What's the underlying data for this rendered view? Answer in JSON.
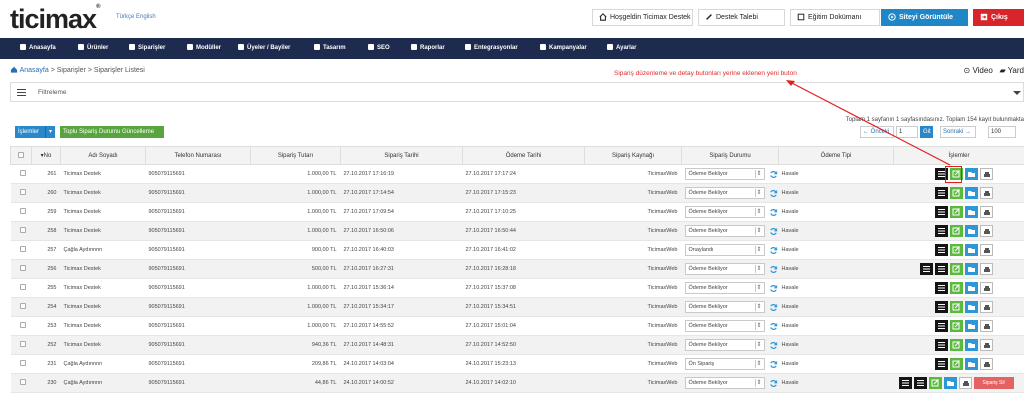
{
  "header": {
    "logo": "ticimax",
    "lang": "Türkçe English",
    "welcome": "Hoşgeldin Ticimax Destek",
    "support": "Destek Talebi",
    "docs": "Eğitim Dokümanı",
    "site": "Siteyi Görüntüle",
    "logout": "Çıkış"
  },
  "nav": [
    "Anasayfa",
    "Ürünler",
    "Siparişler",
    "Modüller",
    "Üyeler / Bayiler",
    "Tasarım",
    "SEO",
    "Raporlar",
    "Entegrasyonlar",
    "Kampanyalar",
    "Ayarlar"
  ],
  "breadcrumb": {
    "home": "Anasayfa",
    "rest": " > Siparişler > Siparişler Listesi"
  },
  "annotation": "Sipariş düzenleme ve detay butonları yerine eklenen yeni buton",
  "video": "Video",
  "yardim": "Yard",
  "filter_label": "Filtreleme",
  "actions": {
    "islemler": "İşlemler",
    "toplu": "Toplu Sipariş Durumu Güncelleme"
  },
  "pager": {
    "info": "Toplam 1 sayfanın 1 sayfasındasınız. Toplam 154 kayıt bulunmakta",
    "prev": "← Önceki",
    "page": "1",
    "go": "Git",
    "next": "Sonraki →",
    "perpage": "100"
  },
  "columns": [
    "",
    "No",
    "Adı Soyadı",
    "Telefon Numarası",
    "Sipariş Tutarı",
    "Sipariş Tarihi",
    "Ödeme Tarihi",
    "Sipariş Kaynağı",
    "Sipariş Durumu",
    "Ödeme Tipi",
    "İşlemler"
  ],
  "rows": [
    {
      "no": "261",
      "name": "Ticimax Destek",
      "phone": "905079115691",
      "amount": "1.000,00 TL",
      "date": "27.10.2017 17:16:19",
      "paid": "27.10.2017 17:17:24",
      "source": "TicimaxWeb",
      "status": "Ödeme Bekliyor",
      "ptype": "Havale"
    },
    {
      "no": "260",
      "name": "Ticimax Destek",
      "phone": "905079115691",
      "amount": "1.000,00 TL",
      "date": "27.10.2017 17:14:54",
      "paid": "27.10.2017 17:15:23",
      "source": "TicimaxWeb",
      "status": "Ödeme Bekliyor",
      "ptype": "Havale"
    },
    {
      "no": "259",
      "name": "Ticimax Destek",
      "phone": "905079115691",
      "amount": "1.000,00 TL",
      "date": "27.10.2017 17:09:54",
      "paid": "27.10.2017 17:10:25",
      "source": "TicimaxWeb",
      "status": "Ödeme Bekliyor",
      "ptype": "Havale"
    },
    {
      "no": "258",
      "name": "Ticimax Destek",
      "phone": "905079115691",
      "amount": "1.000,00 TL",
      "date": "27.10.2017 16:50:06",
      "paid": "27.10.2017 16:50:44",
      "source": "TicimaxWeb",
      "status": "Ödeme Bekliyor",
      "ptype": "Havale"
    },
    {
      "no": "257",
      "name": "Çağla Aydınnnn",
      "phone": "905079115691",
      "amount": "900,00 TL",
      "date": "27.10.2017 16:40:03",
      "paid": "27.10.2017 16:41:02",
      "source": "TicimaxWeb",
      "status": "Onaylandı",
      "ptype": "Havale"
    },
    {
      "no": "256",
      "name": "Ticimax Destek",
      "phone": "905079115691",
      "amount": "500,00 TL",
      "date": "27.10.2017 16:27:31",
      "paid": "27.10.2017 16:28:18",
      "source": "TicimaxWeb",
      "status": "Ödeme Bekliyor",
      "ptype": "Havale"
    },
    {
      "no": "255",
      "name": "Ticimax Destek",
      "phone": "905079115691",
      "amount": "1.000,00 TL",
      "date": "27.10.2017 15:36:14",
      "paid": "27.10.2017 15:37:08",
      "source": "TicimaxWeb",
      "status": "Ödeme Bekliyor",
      "ptype": "Havale"
    },
    {
      "no": "254",
      "name": "Ticimax Destek",
      "phone": "905079115691",
      "amount": "1.000,00 TL",
      "date": "27.10.2017 15:34:17",
      "paid": "27.10.2017 15:34:51",
      "source": "TicimaxWeb",
      "status": "Ödeme Bekliyor",
      "ptype": "Havale"
    },
    {
      "no": "253",
      "name": "Ticimax Destek",
      "phone": "905079115691",
      "amount": "1.000,00 TL",
      "date": "27.10.2017 14:55:52",
      "paid": "27.10.2017 15:01:04",
      "source": "TicimaxWeb",
      "status": "Ödeme Bekliyor",
      "ptype": "Havale"
    },
    {
      "no": "252",
      "name": "Ticimax Destek",
      "phone": "905079115691",
      "amount": "940,36 TL",
      "date": "27.10.2017 14:48:31",
      "paid": "27.10.2017 14:52:50",
      "source": "TicimaxWeb",
      "status": "Ödeme Bekliyor",
      "ptype": "Havale"
    },
    {
      "no": "231",
      "name": "Çağla Aydınnnn",
      "phone": "905079115691",
      "amount": "209,86 TL",
      "date": "24.10.2017 14:03:04",
      "paid": "24.10.2017 15:23:13",
      "source": "TicimaxWeb",
      "status": "Ön Sipariş",
      "ptype": "Havale"
    },
    {
      "no": "230",
      "name": "Çağla Aydınnnn",
      "phone": "905079115691",
      "amount": "44,86 TL",
      "date": "24.10.2017 14:00:52",
      "paid": "24.10.2017 14:02:10",
      "source": "TicimaxWeb",
      "status": "Ödeme Bekliyor",
      "ptype": "Havale"
    }
  ],
  "delete_label": "Sipariş Sil",
  "colors": {
    "nav": "#1d2b4f",
    "blue": "#1f86c8",
    "red": "#d8252b",
    "green": "#5cb93f",
    "annotation": "#e02b2b"
  }
}
